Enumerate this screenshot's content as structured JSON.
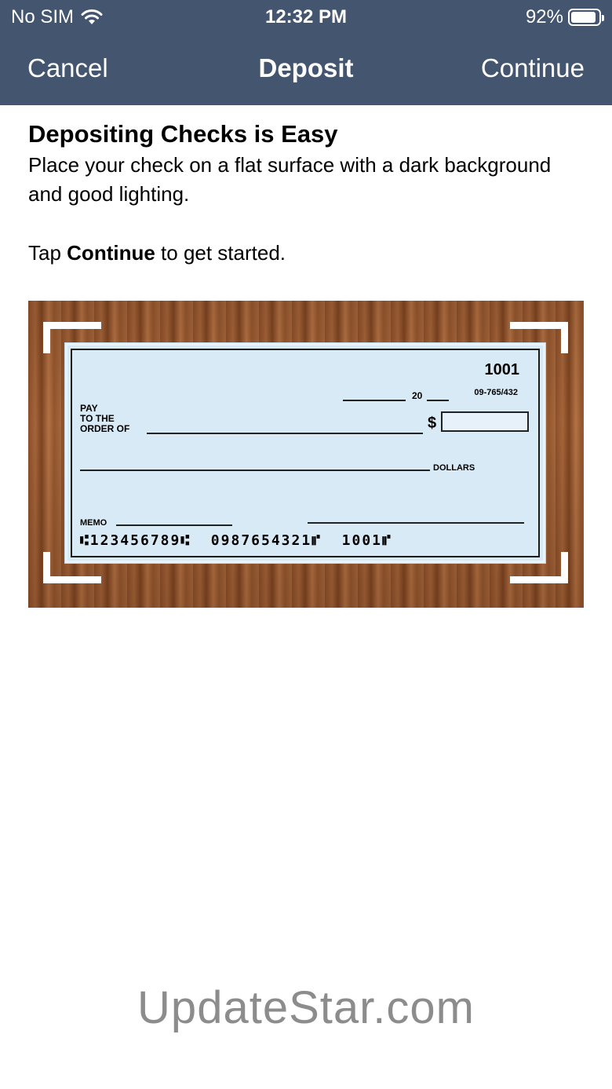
{
  "status_bar": {
    "carrier": "No SIM",
    "time": "12:32 PM",
    "battery": "92%",
    "battery_level": 0.92,
    "wifi_icon": "wifi-icon",
    "battery_icon": "battery-icon"
  },
  "nav": {
    "cancel_label": "Cancel",
    "title": "Deposit",
    "continue_label": "Continue"
  },
  "intro": {
    "heading": "Depositing Checks is Easy",
    "body": "Place your check on a flat surface with a dark background and good lighting.",
    "tap_prefix": "Tap ",
    "tap_bold": "Continue",
    "tap_suffix": " to get started."
  },
  "check": {
    "number": "1001",
    "routing": "09-765/432",
    "date_year_prefix": "20",
    "pay_label": "PAY\nTO THE\nORDER OF",
    "dollar_symbol": "$",
    "dollars_label": "DOLLARS",
    "memo_label": "MEMO",
    "micr_line": "⑆123456789⑆  0987654321⑈  1001⑈"
  },
  "watermark": "UpdateStar.com",
  "colors": {
    "header_bg": "#43556f",
    "check_bg": "#d8eaf6",
    "wood": "#a0623a"
  }
}
